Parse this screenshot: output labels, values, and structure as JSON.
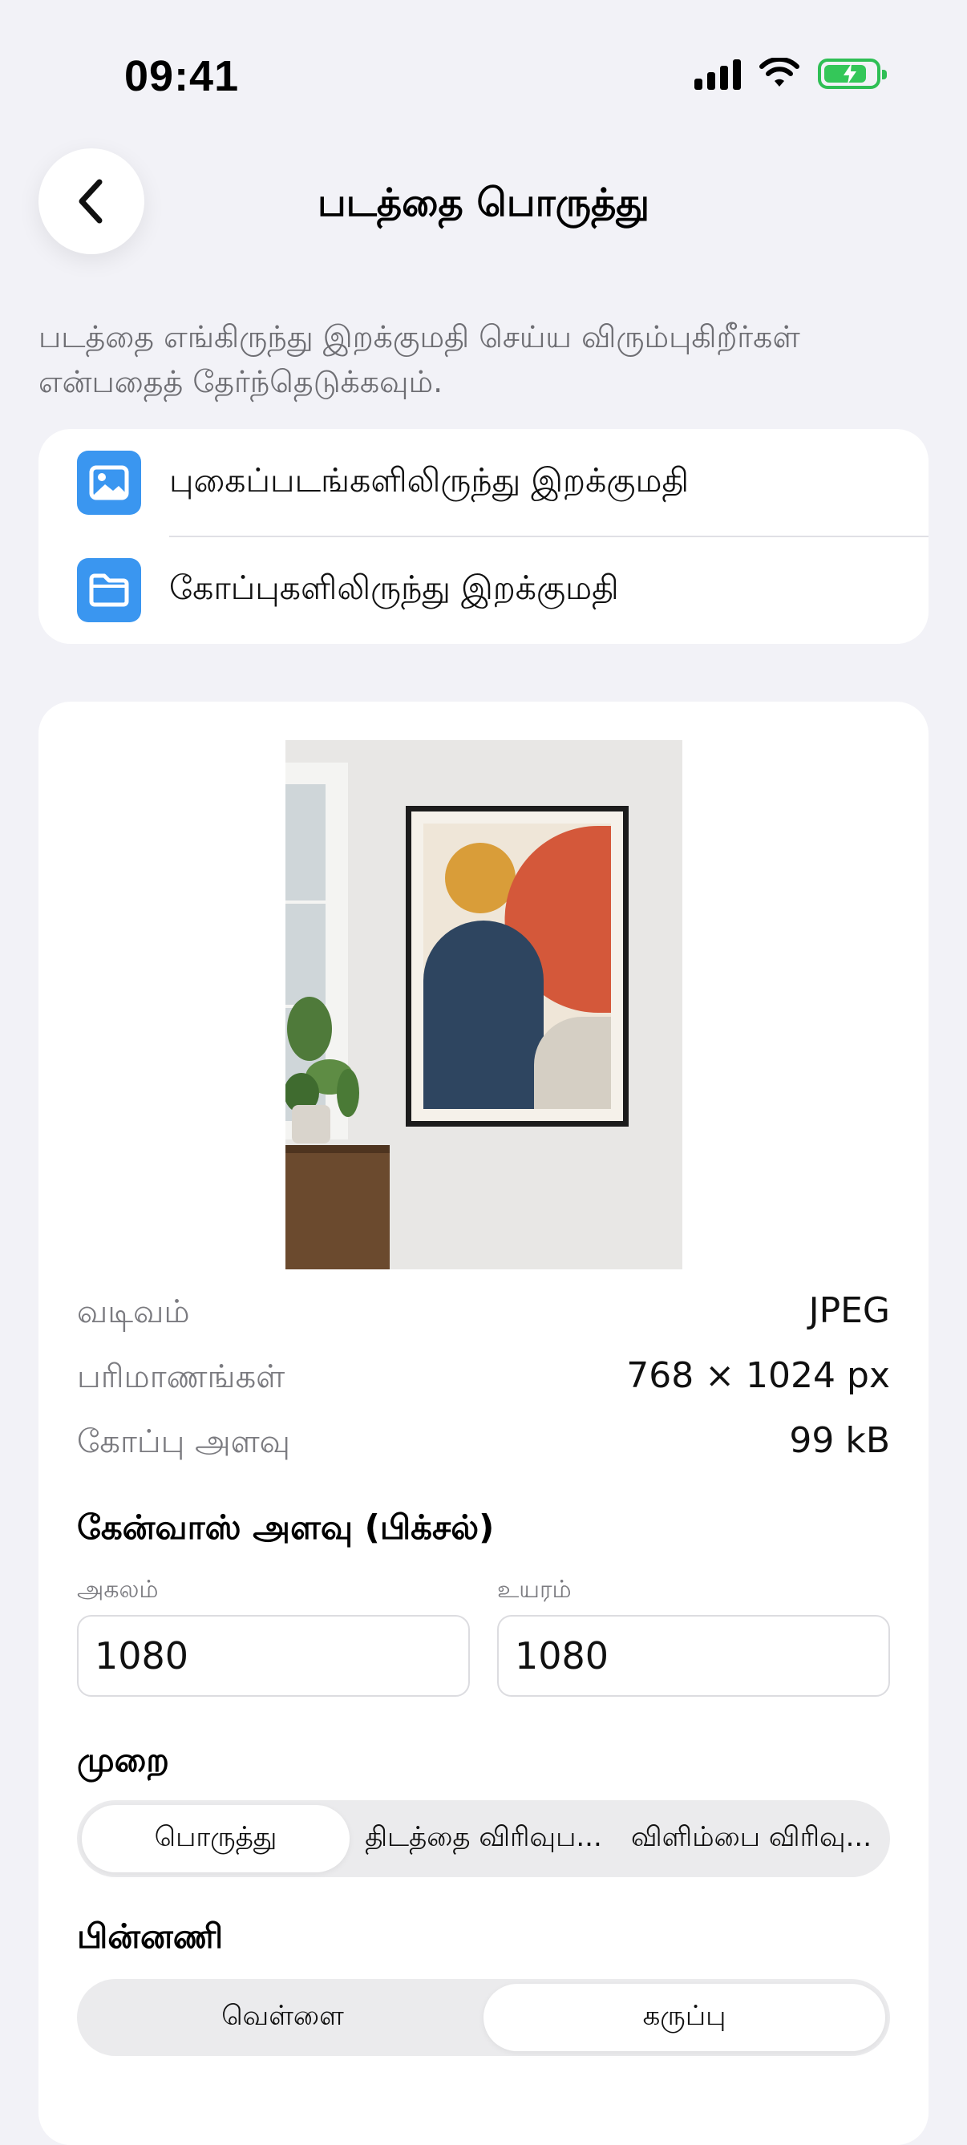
{
  "status_bar": {
    "time": "09:41"
  },
  "header": {
    "title": "படத்தை பொருத்து"
  },
  "subtitle": "படத்தை எங்கிருந்து இறக்குமதி செய்ய விரும்புகிறீர்கள் என்பதைத் தேர்ந்தெடுக்கவும்.",
  "import_options": [
    {
      "label": "புகைப்படங்களிலிருந்து இறக்குமதி",
      "icon": "photo-icon"
    },
    {
      "label": "கோப்புகளிலிருந்து இறக்குமதி",
      "icon": "folder-icon"
    }
  ],
  "image_info": {
    "format_label": "வடிவம்",
    "format_value": "JPEG",
    "dimensions_label": "பரிமாணங்கள்",
    "dimensions_value": "768 × 1024 px",
    "size_label": "கோப்பு அளவு",
    "size_value": "99 kB"
  },
  "canvas": {
    "title": "கேன்வாஸ் அளவு (பிக்சல்)",
    "width_label": "அகலம்",
    "width_value": "1080",
    "height_label": "உயரம்",
    "height_value": "1080"
  },
  "mode": {
    "title": "முறை",
    "options": [
      "பொருத்து",
      "திடத்தை விரிவுப...",
      "விளிம்பை விரிவு..."
    ],
    "selected": "பொருத்து"
  },
  "background": {
    "title": "பின்னணி",
    "options": [
      "வெள்ளை",
      "கருப்பு"
    ],
    "selected": "கருப்பு"
  },
  "colors": {
    "accent": "#3a96f0",
    "battery": "#34c759",
    "page_bg": "#f2f2f7"
  }
}
